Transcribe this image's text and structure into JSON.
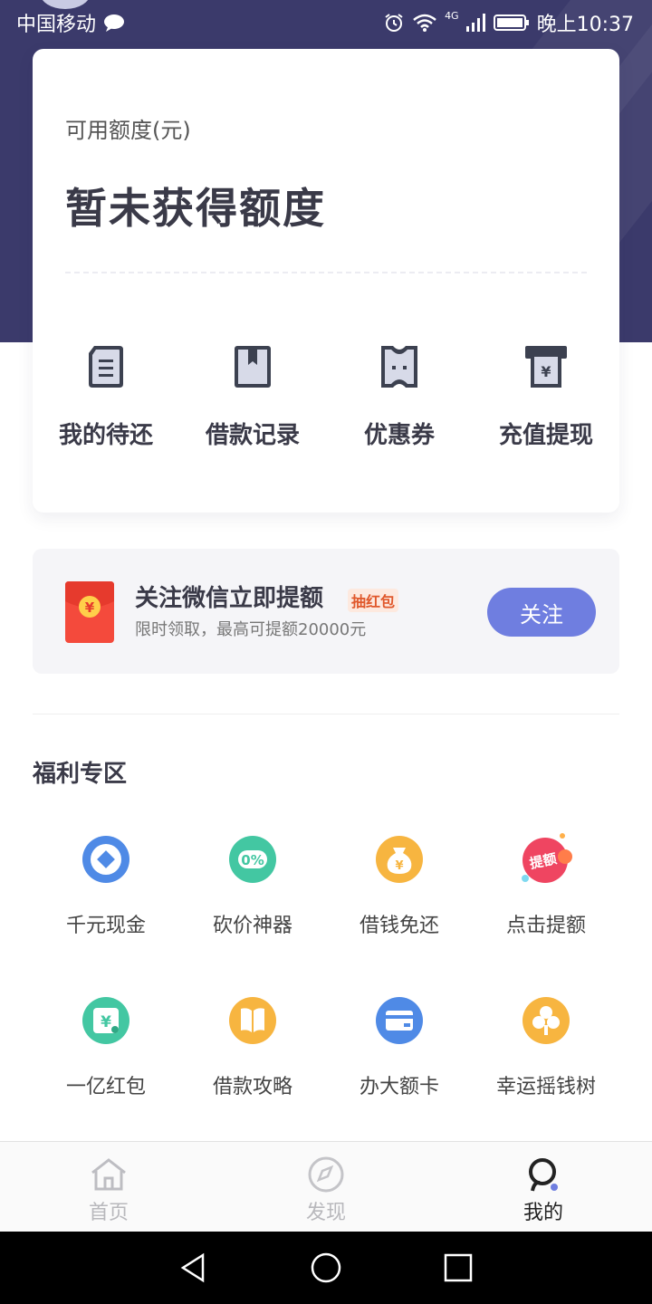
{
  "status_bar": {
    "carrier": "中国移动",
    "network": "4G",
    "time": "晚上10:37"
  },
  "card": {
    "quota_label": "可用额度(元)",
    "quota_value": "暂未获得额度",
    "actions": [
      {
        "label": "我的待还",
        "icon": "document-icon"
      },
      {
        "label": "借款记录",
        "icon": "bookmark-icon"
      },
      {
        "label": "优惠券",
        "icon": "coupon-icon"
      },
      {
        "label": "充值提现",
        "icon": "withdraw-icon"
      }
    ]
  },
  "banner": {
    "title": "关注微信立即提额",
    "tag": "抽红包",
    "subtitle": "限时领取，最高可提额20000元",
    "button": "关注",
    "icon_symbol": "¥"
  },
  "welfare": {
    "title": "福利专区",
    "rows": [
      [
        {
          "label": "千元现金",
          "icon": "diamond-coin-icon"
        },
        {
          "label": "砍价神器",
          "icon": "zero-percent-icon",
          "glyph": "0%"
        },
        {
          "label": "借钱免还",
          "icon": "money-bag-icon"
        },
        {
          "label": "点击提额",
          "icon": "raise-limit-icon",
          "glyph": "提额"
        }
      ],
      [
        {
          "label": "一亿红包",
          "icon": "yen-envelope-icon",
          "glyph": "¥"
        },
        {
          "label": "借款攻略",
          "icon": "book-icon"
        },
        {
          "label": "办大额卡",
          "icon": "credit-card-icon"
        },
        {
          "label": "幸运摇钱树",
          "icon": "money-tree-icon"
        }
      ]
    ]
  },
  "tabbar": [
    {
      "label": "首页",
      "icon": "home-icon",
      "active": false
    },
    {
      "label": "发现",
      "icon": "compass-icon",
      "active": false
    },
    {
      "label": "我的",
      "icon": "profile-icon",
      "active": true
    }
  ],
  "colors": {
    "header_bg": "#3b3a6b",
    "accent": "#6f7ee0",
    "tag": "#e0582b"
  }
}
